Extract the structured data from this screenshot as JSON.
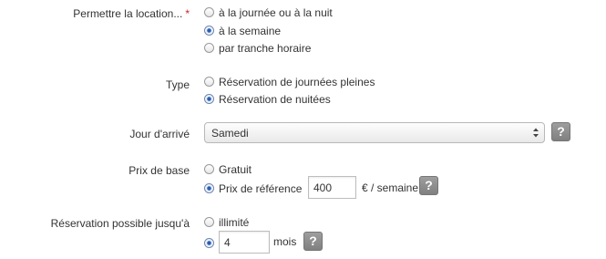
{
  "rental_mode": {
    "label": "Permettre la location...",
    "required_mark": "*",
    "options": [
      {
        "label": "à la journée ou à la nuit",
        "checked": false
      },
      {
        "label": "à la semaine",
        "checked": true
      },
      {
        "label": "par tranche horaire",
        "checked": false
      }
    ]
  },
  "type": {
    "label": "Type",
    "options": [
      {
        "label": "Réservation de journées pleines",
        "checked": false
      },
      {
        "label": "Réservation de nuitées",
        "checked": true
      }
    ]
  },
  "arrival_day": {
    "label": "Jour d'arrivé",
    "selected": "Samedi",
    "help": "?"
  },
  "base_price": {
    "label": "Prix de base",
    "free_label": "Gratuit",
    "free_checked": false,
    "ref_label": "Prix de référence",
    "ref_checked": true,
    "value": "400",
    "unit": "€ / semaine",
    "help": "?"
  },
  "booking_limit": {
    "label": "Réservation possible jusqu'à",
    "unlimited_label": "illimité",
    "unlimited_checked": false,
    "limited_checked": true,
    "value": "4",
    "unit": "mois",
    "help": "?"
  },
  "colors": {
    "radio_selected": "#2a5db0",
    "required_mark": "#cc2222",
    "help_button": "#8c8c8c"
  }
}
